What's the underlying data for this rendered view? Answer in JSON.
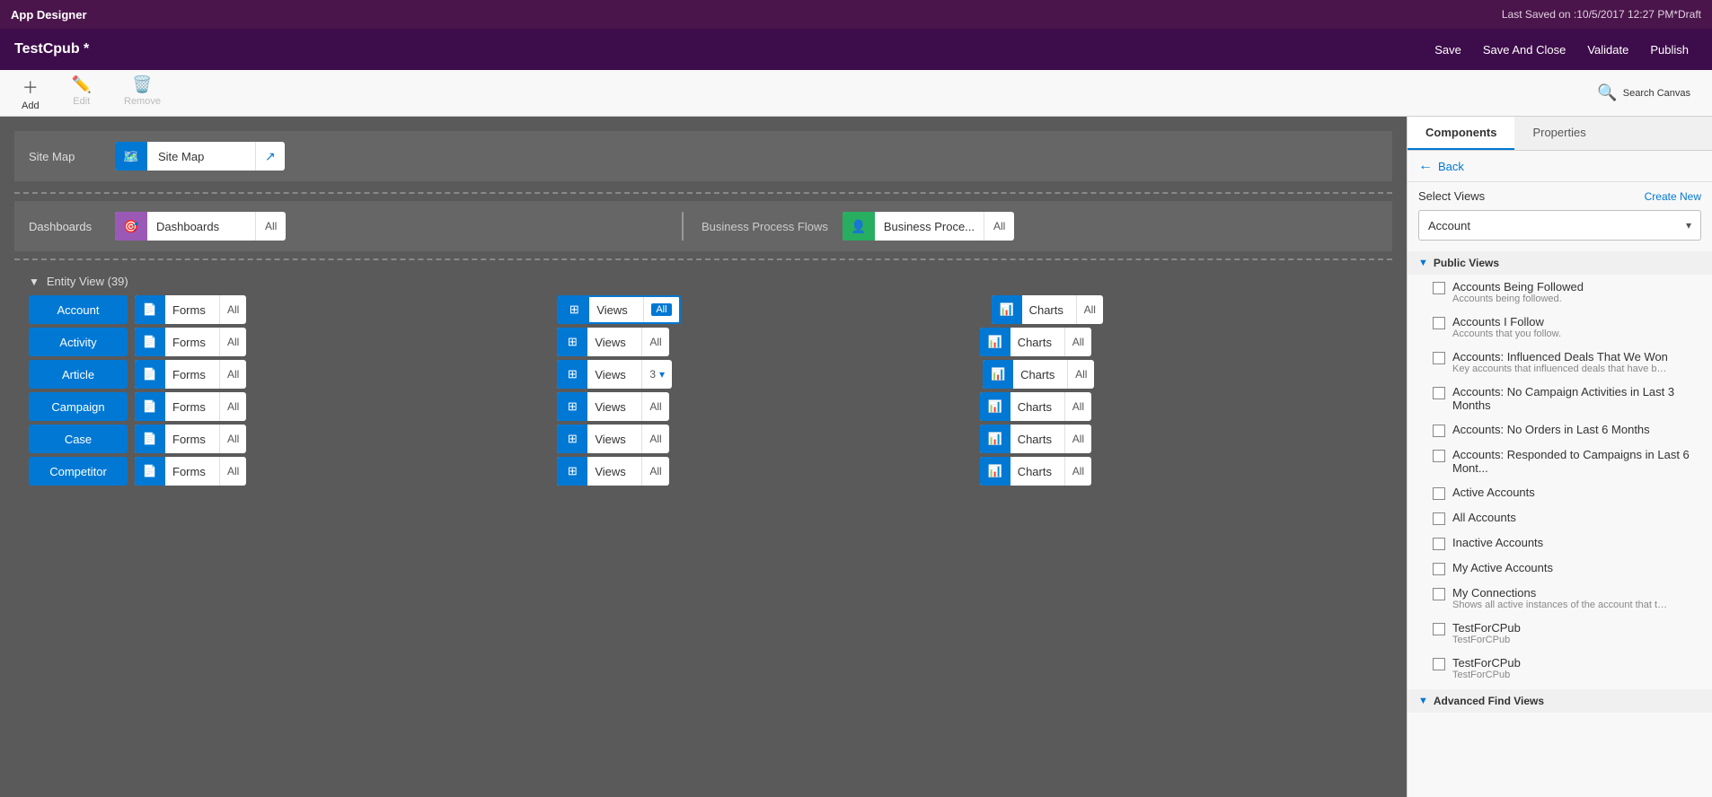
{
  "topBar": {
    "title": "App Designer",
    "lastSaved": "Last Saved on :10/5/2017 12:27 PM*Draft"
  },
  "titleBar": {
    "appName": "TestCpub *",
    "buttons": {
      "save": "Save",
      "saveAndClose": "Save And Close",
      "validate": "Validate",
      "publish": "Publish"
    }
  },
  "toolbar": {
    "add": "Add",
    "edit": "Edit",
    "remove": "Remove",
    "searchCanvas": "Search Canvas"
  },
  "canvas": {
    "siteMap": {
      "label": "Site Map",
      "name": "Site Map"
    },
    "dashboards": {
      "label": "Dashboards",
      "name": "Dashboards",
      "badge": "All",
      "bpfLabel": "Business Process Flows",
      "bpfName": "Business Proce...",
      "bpfBadge": "All"
    },
    "entityView": {
      "title": "Entity View (39)",
      "entities": [
        {
          "name": "Account",
          "forms": {
            "label": "Forms",
            "badge": "All"
          },
          "views": {
            "label": "Views",
            "badge": "All",
            "highlighted": true
          },
          "charts": {
            "label": "Charts",
            "badge": "All"
          }
        },
        {
          "name": "Activity",
          "forms": {
            "label": "Forms",
            "badge": "All"
          },
          "views": {
            "label": "Views",
            "badge": "All"
          },
          "charts": {
            "label": "Charts",
            "badge": "All"
          }
        },
        {
          "name": "Article",
          "forms": {
            "label": "Forms",
            "badge": "All"
          },
          "views": {
            "label": "Views",
            "badge": "3",
            "hasDropdown": true
          },
          "charts": {
            "label": "Charts",
            "badge": "All"
          }
        },
        {
          "name": "Campaign",
          "forms": {
            "label": "Forms",
            "badge": "All"
          },
          "views": {
            "label": "Views",
            "badge": "All"
          },
          "charts": {
            "label": "Charts",
            "badge": "All"
          }
        },
        {
          "name": "Case",
          "forms": {
            "label": "Forms",
            "badge": "All"
          },
          "views": {
            "label": "Views",
            "badge": "All"
          },
          "charts": {
            "label": "Charts",
            "badge": "All"
          }
        },
        {
          "name": "Competitor",
          "forms": {
            "label": "Forms",
            "badge": "All"
          },
          "views": {
            "label": "Views",
            "badge": "All"
          },
          "charts": {
            "label": "Charts",
            "badge": "All"
          }
        }
      ]
    }
  },
  "rightPanel": {
    "tabs": {
      "components": "Components",
      "properties": "Properties"
    },
    "back": "Back",
    "selectViews": "Select Views",
    "createNew": "Create New",
    "dropdownValue": "Account",
    "publicViewsSection": "Public Views",
    "viewItems": [
      {
        "name": "Accounts Being Followed",
        "desc": "Accounts being followed."
      },
      {
        "name": "Accounts I Follow",
        "desc": "Accounts that you follow."
      },
      {
        "name": "Accounts: Influenced Deals That We Won",
        "desc": "Key accounts that influenced deals that have been w..."
      },
      {
        "name": "Accounts: No Campaign Activities in Last 3 Months",
        "desc": ""
      },
      {
        "name": "Accounts: No Orders in Last 6 Months",
        "desc": ""
      },
      {
        "name": "Accounts: Responded to Campaigns in Last 6 Mont...",
        "desc": ""
      },
      {
        "name": "Active Accounts",
        "desc": ""
      },
      {
        "name": "All Accounts",
        "desc": ""
      },
      {
        "name": "Inactive Accounts",
        "desc": ""
      },
      {
        "name": "My Active Accounts",
        "desc": ""
      },
      {
        "name": "My Connections",
        "desc": "Shows all active instances of the account that the cu..."
      },
      {
        "name": "TestForCPub",
        "desc": "TestForCPub"
      },
      {
        "name": "TestForCPub",
        "desc": "TestForCPub"
      }
    ],
    "advancedFindViews": "Advanced Find Views"
  }
}
